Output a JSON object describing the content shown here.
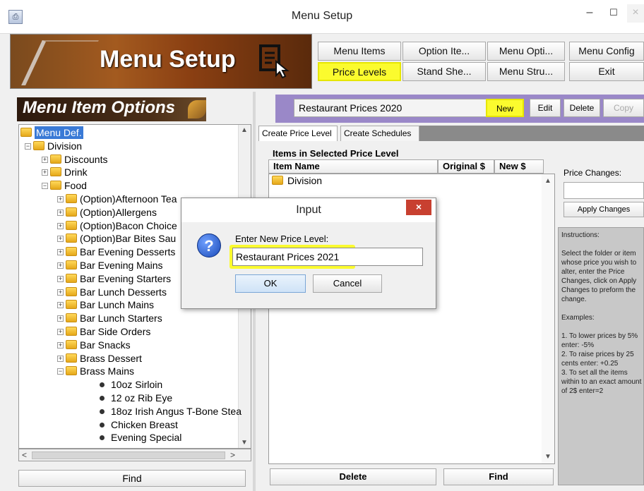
{
  "window": {
    "title": "Menu Setup",
    "min_glyph": "–",
    "max_glyph": "☐",
    "close_glyph": "×",
    "app_icon_glyph": "⎙"
  },
  "banner": {
    "title": "Menu Setup",
    "icon": "document-cursor-icon"
  },
  "header_buttons": [
    {
      "label": "Menu Items",
      "highlighted": false
    },
    {
      "label": "Option Ite...",
      "highlighted": false
    },
    {
      "label": "Menu Opti...",
      "highlighted": false
    },
    {
      "label": "Menu Config",
      "highlighted": false
    },
    {
      "label": "Price Levels",
      "highlighted": true
    },
    {
      "label": "Stand She...",
      "highlighted": false
    },
    {
      "label": "Menu Stru...",
      "highlighted": false
    },
    {
      "label": "Exit",
      "highlighted": false
    }
  ],
  "left_panel": {
    "title": "Menu Item Options",
    "find_label": "Find",
    "tree": [
      {
        "label": "Menu Def.",
        "level": 0,
        "kind": "folder",
        "selected": true
      },
      {
        "label": "Division",
        "level": 1,
        "kind": "folder",
        "expander": "−"
      },
      {
        "label": "Discounts",
        "level": 2,
        "kind": "folder",
        "expander": "+"
      },
      {
        "label": "Drink",
        "level": 2,
        "kind": "folder",
        "expander": "+"
      },
      {
        "label": "Food",
        "level": 2,
        "kind": "folder",
        "expander": "−"
      },
      {
        "label": "(Option)Afternoon Tea",
        "level": 3,
        "kind": "folder",
        "expander": "+"
      },
      {
        "label": "(Option)Allergens",
        "level": 3,
        "kind": "folder",
        "expander": "+"
      },
      {
        "label": "(Option)Bacon Choice",
        "level": 3,
        "kind": "folder",
        "expander": "+"
      },
      {
        "label": "(Option)Bar Bites Sau",
        "level": 3,
        "kind": "folder",
        "expander": "+"
      },
      {
        "label": "Bar Evening Desserts",
        "level": 3,
        "kind": "folder",
        "expander": "+"
      },
      {
        "label": "Bar Evening Mains",
        "level": 3,
        "kind": "folder",
        "expander": "+"
      },
      {
        "label": "Bar Evening Starters",
        "level": 3,
        "kind": "folder",
        "expander": "+"
      },
      {
        "label": "Bar Lunch Desserts",
        "level": 3,
        "kind": "folder",
        "expander": "+"
      },
      {
        "label": "Bar Lunch Mains",
        "level": 3,
        "kind": "folder",
        "expander": "+"
      },
      {
        "label": "Bar Lunch Starters",
        "level": 3,
        "kind": "folder",
        "expander": "+"
      },
      {
        "label": "Bar Side Orders",
        "level": 3,
        "kind": "folder",
        "expander": "+"
      },
      {
        "label": "Bar Snacks",
        "level": 3,
        "kind": "folder",
        "expander": "+"
      },
      {
        "label": "Brass Dessert",
        "level": 3,
        "kind": "folder",
        "expander": "+"
      },
      {
        "label": "Brass Mains",
        "level": 3,
        "kind": "folder",
        "expander": "−"
      },
      {
        "label": "10oz Sirloin",
        "level": 4,
        "kind": "item"
      },
      {
        "label": "12 oz Rib Eye",
        "level": 4,
        "kind": "item"
      },
      {
        "label": "18oz Irish Angus T-Bone Stea",
        "level": 4,
        "kind": "item"
      },
      {
        "label": "Chicken Breast",
        "level": 4,
        "kind": "item"
      },
      {
        "label": "Evening Special",
        "level": 4,
        "kind": "item"
      }
    ]
  },
  "price_bar": {
    "selected_level": "Restaurant Prices 2020",
    "chevron": "∨",
    "buttons": [
      {
        "label": "New",
        "highlighted": true,
        "disabled": false
      },
      {
        "label": "Edit",
        "highlighted": false,
        "disabled": false
      },
      {
        "label": "Delete",
        "highlighted": false,
        "disabled": false
      },
      {
        "label": "Copy",
        "highlighted": false,
        "disabled": true
      }
    ]
  },
  "tabs": [
    {
      "label": "Create Price Level",
      "active": true
    },
    {
      "label": "Create Schedules",
      "active": false
    }
  ],
  "items_panel": {
    "title": "Items in Selected Price Level",
    "columns": [
      "Item Name",
      "Original $",
      "New $"
    ],
    "rows": [
      {
        "name": "Division",
        "kind": "folder"
      }
    ],
    "delete_label": "Delete",
    "find_label": "Find"
  },
  "side_panel": {
    "price_changes_label": "Price Changes:",
    "price_changes_value": "",
    "apply_label": "Apply Changes",
    "instructions": "Instructions:\n\nSelect the folder or item whose price you wish to alter, enter the Price Changes, click on Apply Changes to preform the change.\n\nExamples:\n\n1. To lower prices by 5% enter: -5%\n2. To raise prices by 25 cents enter: +0.25\n3. To set all the items within to an exact amount of 2$ enter=2"
  },
  "dialog": {
    "title": "Input",
    "close_glyph": "×",
    "icon_glyph": "?",
    "prompt": "Enter New Price Level:",
    "value": "Restaurant Prices 2021",
    "ok_label": "OK",
    "cancel_label": "Cancel"
  },
  "colors": {
    "highlight": "#fbfb2e",
    "purple_bar": "#9a88c8",
    "selection": "#3a7ad6",
    "close_red": "#c84030"
  }
}
